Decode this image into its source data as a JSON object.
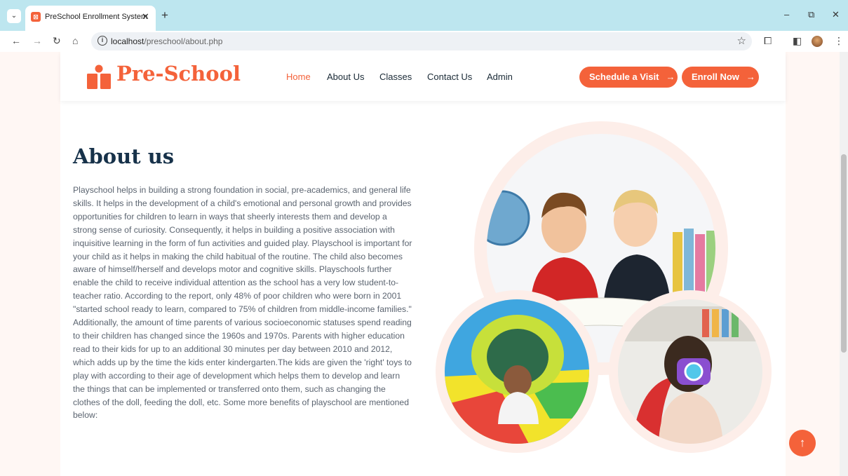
{
  "browser": {
    "tab_title": "PreSchool Enrollment System",
    "url_host": "localhost",
    "url_path": "/preschool/about.php"
  },
  "site": {
    "logo_text": "Pre-School",
    "nav": [
      {
        "label": "Home",
        "active": true
      },
      {
        "label": "About Us",
        "active": false
      },
      {
        "label": "Classes",
        "active": false
      },
      {
        "label": "Contact Us",
        "active": false
      },
      {
        "label": "Admin",
        "active": false
      }
    ],
    "buttons": {
      "schedule": "Schedule a Visit",
      "enroll": "Enroll Now"
    }
  },
  "about": {
    "title": "About us",
    "body": "Playschool helps in building a strong foundation in social, pre-academics, and general life skills. It helps in the development of a child's emotional and personal growth and provides opportunities for children to learn in ways that sheerly interests them and develop a strong sense of curiosity. Consequently, it helps in building a positive association with inquisitive learning in the form of fun activities and guided play. Playschool is important for your child as it helps in making the child habitual of the routine. The child also becomes aware of himself/herself and develops motor and cognitive skills. Playschools further enable the child to receive individual attention as the school has a very low student-to-teacher ratio. According to the report, only 48% of poor children who were born in 2001 \"started school ready to learn, compared to 75% of children from middle-income families.\" Additionally, the amount of time parents of various socioeconomic statuses spend reading to their children has changed since the 1960s and 1970s. Parents with higher education read to their kids for up to an additional 30 minutes per day between 2010 and 2012, which adds up by the time the kids enter kindergarten.The kids are given the 'right' toys to play with according to their age of development which helps them to develop and learn the things that can be implemented or transferred onto them, such as changing the clothes of the doll, feeding the doll, etc. Some more benefits of playschool are mentioned below:"
  },
  "colors": {
    "accent": "#f4623a",
    "heading": "#17324a",
    "body_text": "#5b6470"
  }
}
